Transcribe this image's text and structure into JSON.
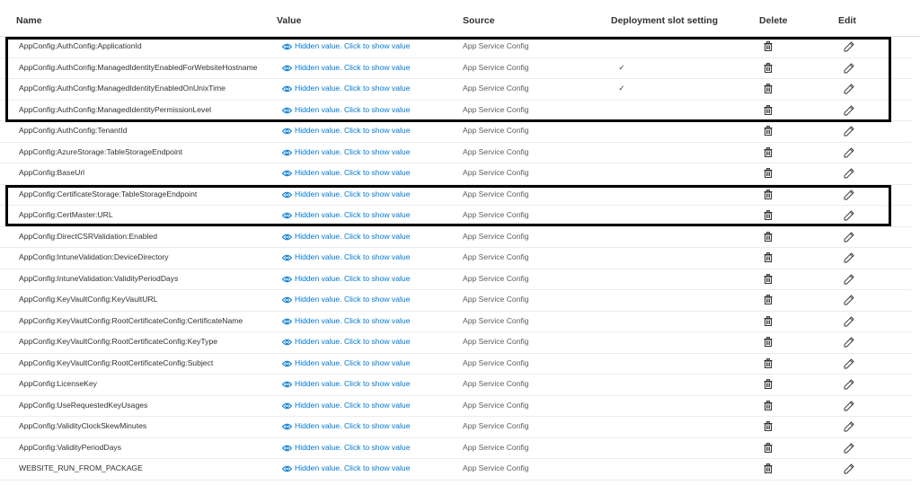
{
  "columns": {
    "name": "Name",
    "value": "Value",
    "source": "Source",
    "slot": "Deployment slot setting",
    "delete": "Delete",
    "edit": "Edit"
  },
  "rows": [
    {
      "name": "AppConfig:AuthConfig:ApplicationId",
      "value": "Hidden value. Click to show value",
      "source": "App Service Config",
      "slot": ""
    },
    {
      "name": "AppConfig:AuthConfig:ManagedIdentityEnabledForWebsiteHostname",
      "value": "Hidden value. Click to show value",
      "source": "App Service Config",
      "slot": "✓"
    },
    {
      "name": "AppConfig:AuthConfig:ManagedIdentityEnabledOnUnixTime",
      "value": "Hidden value. Click to show value",
      "source": "App Service Config",
      "slot": "✓"
    },
    {
      "name": "AppConfig:AuthConfig:ManagedIdentityPermissionLevel",
      "value": "Hidden value. Click to show value",
      "source": "App Service Config",
      "slot": ""
    },
    {
      "name": "AppConfig:AuthConfig:TenantId",
      "value": "Hidden value. Click to show value",
      "source": "App Service Config",
      "slot": ""
    },
    {
      "name": "AppConfig:AzureStorage:TableStorageEndpoint",
      "value": "Hidden value. Click to show value",
      "source": "App Service Config",
      "slot": ""
    },
    {
      "name": "AppConfig:BaseUrl",
      "value": "Hidden value. Click to show value",
      "source": "App Service Config",
      "slot": ""
    },
    {
      "name": "AppConfig:CertificateStorage:TableStorageEndpoint",
      "value": "Hidden value. Click to show value",
      "source": "App Service Config",
      "slot": ""
    },
    {
      "name": "AppConfig:CertMaster:URL",
      "value": "Hidden value. Click to show value",
      "source": "App Service Config",
      "slot": ""
    },
    {
      "name": "AppConfig:DirectCSRValidation:Enabled",
      "value": "Hidden value. Click to show value",
      "source": "App Service Config",
      "slot": ""
    },
    {
      "name": "AppConfig:IntuneValidation:DeviceDirectory",
      "value": "Hidden value. Click to show value",
      "source": "App Service Config",
      "slot": ""
    },
    {
      "name": "AppConfig:IntuneValidation:ValidityPeriodDays",
      "value": "Hidden value. Click to show value",
      "source": "App Service Config",
      "slot": ""
    },
    {
      "name": "AppConfig:KeyVaultConfig:KeyVaultURL",
      "value": "Hidden value. Click to show value",
      "source": "App Service Config",
      "slot": ""
    },
    {
      "name": "AppConfig:KeyVaultConfig:RootCertificateConfig:CertificateName",
      "value": "Hidden value. Click to show value",
      "source": "App Service Config",
      "slot": ""
    },
    {
      "name": "AppConfig:KeyVaultConfig:RootCertificateConfig:KeyType",
      "value": "Hidden value. Click to show value",
      "source": "App Service Config",
      "slot": ""
    },
    {
      "name": "AppConfig:KeyVaultConfig:RootCertificateConfig:Subject",
      "value": "Hidden value. Click to show value",
      "source": "App Service Config",
      "slot": ""
    },
    {
      "name": "AppConfig:LicenseKey",
      "value": "Hidden value. Click to show value",
      "source": "App Service Config",
      "slot": ""
    },
    {
      "name": "AppConfig:UseRequestedKeyUsages",
      "value": "Hidden value. Click to show value",
      "source": "App Service Config",
      "slot": ""
    },
    {
      "name": "AppConfig:ValidityClockSkewMinutes",
      "value": "Hidden value. Click to show value",
      "source": "App Service Config",
      "slot": ""
    },
    {
      "name": "AppConfig:ValidityPeriodDays",
      "value": "Hidden value. Click to show value",
      "source": "App Service Config",
      "slot": ""
    },
    {
      "name": "WEBSITE_RUN_FROM_PACKAGE",
      "value": "Hidden value. Click to show value",
      "source": "App Service Config",
      "slot": ""
    }
  ],
  "icons": {
    "value": "eye-icon",
    "delete": "trash-icon",
    "edit": "pencil-icon"
  },
  "colors": {
    "link": "#0078d4",
    "text": "#323130",
    "secondary_text": "#605e5c",
    "highlight_border": "#000000"
  }
}
